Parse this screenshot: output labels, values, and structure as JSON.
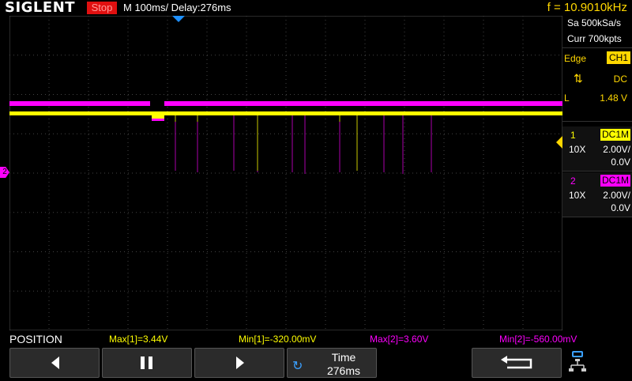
{
  "topbar": {
    "logo": "SIGLENT",
    "status": "Stop",
    "timebase": "M 100ms/  Delay:276ms",
    "frequency": "f = 10.9010kHz"
  },
  "acquisition": {
    "sample_rate": "Sa 500kSa/s",
    "memory": "Curr 700kpts"
  },
  "trigger": {
    "type": "Edge",
    "source": "CH1",
    "slope_icon": "rising-falling-edge-icon",
    "coupling": "DC",
    "level_label": "L",
    "level": "1.48 V"
  },
  "channels": [
    {
      "num": "1",
      "coupling": "DC1M",
      "probe": "10X",
      "scale": "2.00V/",
      "offset": "0.0V",
      "color": "#ffff00"
    },
    {
      "num": "2",
      "coupling": "DC1M",
      "probe": "10X",
      "scale": "2.00V/",
      "offset": "0.0V",
      "color": "#ff00ff"
    }
  ],
  "measurements": {
    "position_label": "POSITION",
    "max1": "Max[1]=3.44V",
    "min1": "Min[1]=-320.00mV",
    "max2": "Max[2]=3.60V",
    "min2": "Min[2]=-560.00mV"
  },
  "softkeys": {
    "left_icon": "triangle-left-icon",
    "pause_icon": "pause-icon",
    "right_icon": "triangle-right-icon",
    "time_label": "Time",
    "time_value": "276ms",
    "back_icon": "return-arrow-icon",
    "net_icon": "network-icon"
  },
  "markers": {
    "ch2_ground": "2"
  }
}
